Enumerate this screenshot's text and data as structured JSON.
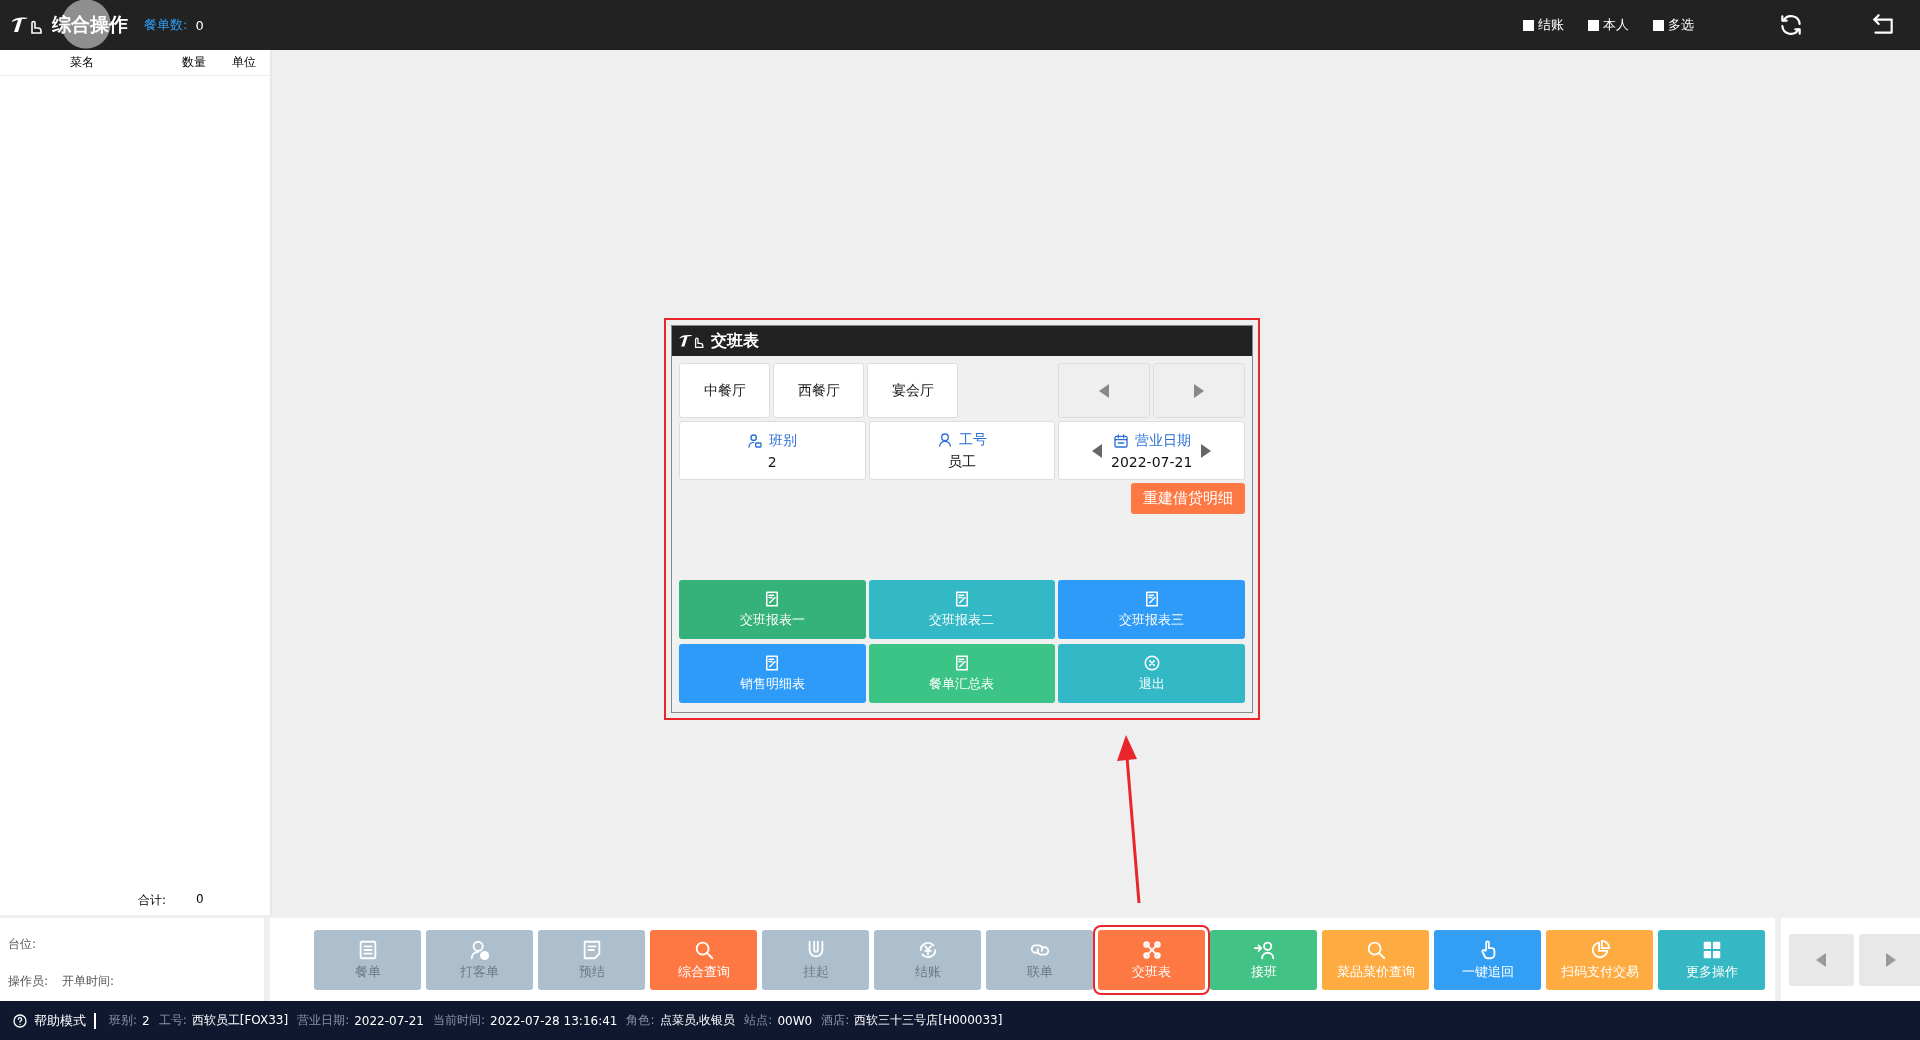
{
  "header": {
    "title": "综合操作",
    "order_count_label": "餐单数:",
    "order_count": "0",
    "options": [
      {
        "label": "结账",
        "checked": false
      },
      {
        "label": "本人",
        "checked": false
      },
      {
        "label": "多选",
        "checked": false
      }
    ]
  },
  "order_list": {
    "columns": [
      "菜名",
      "数量",
      "单位"
    ],
    "total_label": "合计:",
    "total": "0"
  },
  "table_info": {
    "seat_label": "台位:",
    "operator_label": "操作员:",
    "open_time_label": "开单时间:"
  },
  "toolbar": [
    {
      "label": "餐单",
      "color": "#adbfcd",
      "disabled": true,
      "annotated": false
    },
    {
      "label": "打客单",
      "color": "#adbfcd",
      "disabled": true,
      "annotated": false
    },
    {
      "label": "预结",
      "color": "#adbfcd",
      "disabled": true,
      "annotated": false
    },
    {
      "label": "综合查询",
      "color": "#fe7843",
      "disabled": false,
      "annotated": false
    },
    {
      "label": "挂起",
      "color": "#adbfcd",
      "disabled": true,
      "annotated": false
    },
    {
      "label": "结账",
      "color": "#adbfcd",
      "disabled": true,
      "annotated": false
    },
    {
      "label": "联单",
      "color": "#adbfcd",
      "disabled": true,
      "annotated": false
    },
    {
      "label": "交班表",
      "color": "#fe7843",
      "disabled": false,
      "annotated": true
    },
    {
      "label": "接班",
      "color": "#43c285",
      "disabled": false,
      "annotated": false
    },
    {
      "label": "菜品菜价查询",
      "color": "#feab42",
      "disabled": false,
      "annotated": false
    },
    {
      "label": "一键追回",
      "color": "#339ff4",
      "disabled": false,
      "annotated": false
    },
    {
      "label": "扫码支付交易",
      "color": "#feab42",
      "disabled": false,
      "annotated": false
    },
    {
      "label": "更多操作",
      "color": "#36b8c4",
      "disabled": false,
      "annotated": false
    }
  ],
  "dialog": {
    "title": "交班表",
    "annotated": true,
    "halls": [
      {
        "label": "中餐厅",
        "selected": false
      },
      {
        "label": "西餐厅",
        "selected": false
      },
      {
        "label": "宴会厅",
        "selected": false
      }
    ],
    "info": [
      {
        "kind": "shift",
        "label": "班别",
        "value": "2"
      },
      {
        "kind": "staff",
        "label": "工号",
        "value": "员工"
      },
      {
        "kind": "date",
        "label": "营业日期",
        "value": "2022-07-21"
      }
    ],
    "rebuild_button": "重建借贷明细",
    "reports": [
      {
        "kind": "report",
        "label": "交班报表一",
        "color": "#34b27a"
      },
      {
        "kind": "report",
        "label": "交班报表二",
        "color": "#33b9c6"
      },
      {
        "kind": "report",
        "label": "交班报表三",
        "color": "#2d9bf7"
      },
      {
        "kind": "report",
        "label": "销售明细表",
        "color": "#2d9bf7"
      },
      {
        "kind": "report",
        "label": "餐单汇总表",
        "color": "#3cc486"
      },
      {
        "kind": "exit",
        "label": "退出",
        "color": "#33b9c6"
      }
    ]
  },
  "status_bar": {
    "help": "帮助模式",
    "fields": [
      {
        "label": "班别:",
        "value": "2"
      },
      {
        "label": "工号:",
        "value": "西软员工[FOX33]"
      },
      {
        "label": "营业日期:",
        "value": "2022-07-21"
      },
      {
        "label": "当前时间:",
        "value": "2022-07-28 13:16:41"
      },
      {
        "label": "角色:",
        "value": "点菜员,收银员"
      },
      {
        "label": "站点:",
        "value": "00W0"
      },
      {
        "label": "酒店:",
        "value": "西软三十三号店[H000033]"
      }
    ]
  }
}
